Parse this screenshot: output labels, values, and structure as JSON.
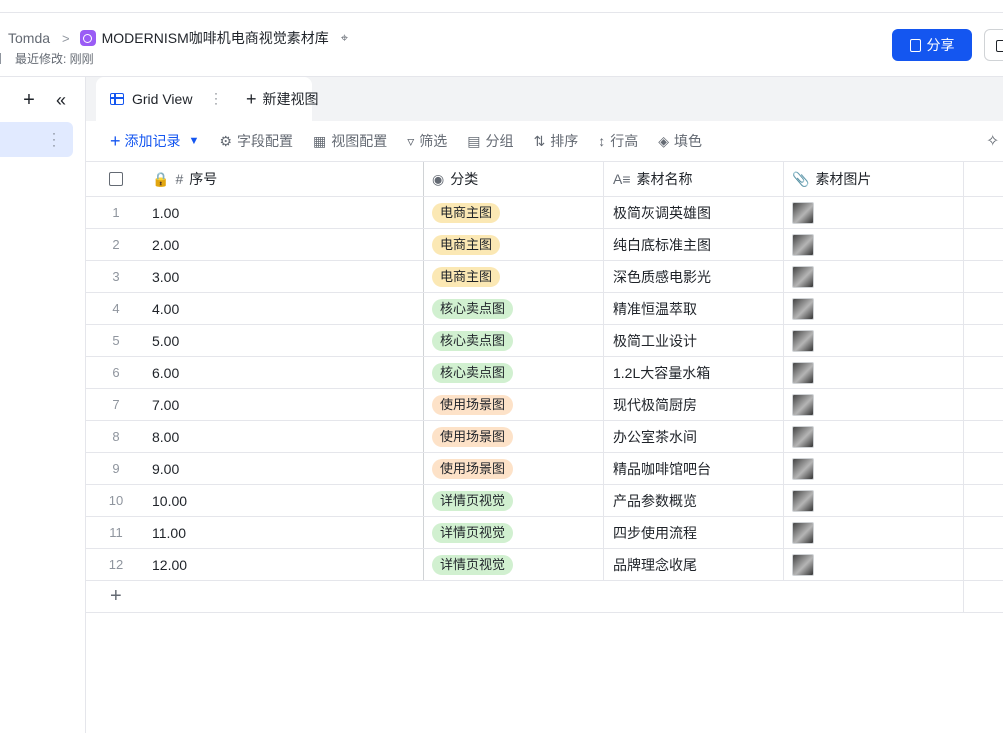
{
  "header": {
    "breadcrumb_root": "Tomda",
    "base_title": "MODERNISM咖啡机电商视觉素材库",
    "modified": "最近修改: 刚刚",
    "share_label": "分享"
  },
  "views": {
    "active_tab": "Grid View",
    "new_view_label": "新建视图"
  },
  "toolbar": {
    "add_record": "添加记录",
    "field_config": "字段配置",
    "view_config": "视图配置",
    "filter": "筛选",
    "group": "分组",
    "sort": "排序",
    "row_height": "行高",
    "fill": "填色"
  },
  "columns": {
    "seq": "序号",
    "category": "分类",
    "name": "素材名称",
    "image": "素材图片"
  },
  "tag_colors": {
    "电商主图": {
      "bg": "#fbe8b4",
      "fg": "#1f2329"
    },
    "核心卖点图": {
      "bg": "#d1f0d0",
      "fg": "#1f2329"
    },
    "使用场景图": {
      "bg": "#fde2c8",
      "fg": "#1f2329"
    },
    "详情页视觉": {
      "bg": "#d1f0d0",
      "fg": "#1f2329"
    }
  },
  "rows": [
    {
      "n": "1",
      "seq": "1.00",
      "category": "电商主图",
      "name": "极简灰调英雄图"
    },
    {
      "n": "2",
      "seq": "2.00",
      "category": "电商主图",
      "name": "纯白底标准主图"
    },
    {
      "n": "3",
      "seq": "3.00",
      "category": "电商主图",
      "name": "深色质感电影光"
    },
    {
      "n": "4",
      "seq": "4.00",
      "category": "核心卖点图",
      "name": "精准恒温萃取"
    },
    {
      "n": "5",
      "seq": "5.00",
      "category": "核心卖点图",
      "name": "极简工业设计"
    },
    {
      "n": "6",
      "seq": "6.00",
      "category": "核心卖点图",
      "name": "1.2L大容量水箱"
    },
    {
      "n": "7",
      "seq": "7.00",
      "category": "使用场景图",
      "name": "现代极简厨房"
    },
    {
      "n": "8",
      "seq": "8.00",
      "category": "使用场景图",
      "name": "办公室茶水间"
    },
    {
      "n": "9",
      "seq": "9.00",
      "category": "使用场景图",
      "name": "精品咖啡馆吧台"
    },
    {
      "n": "10",
      "seq": "10.00",
      "category": "详情页视觉",
      "name": "产品参数概览"
    },
    {
      "n": "11",
      "seq": "11.00",
      "category": "详情页视觉",
      "name": "四步使用流程"
    },
    {
      "n": "12",
      "seq": "12.00",
      "category": "详情页视觉",
      "name": "品牌理念收尾"
    }
  ]
}
